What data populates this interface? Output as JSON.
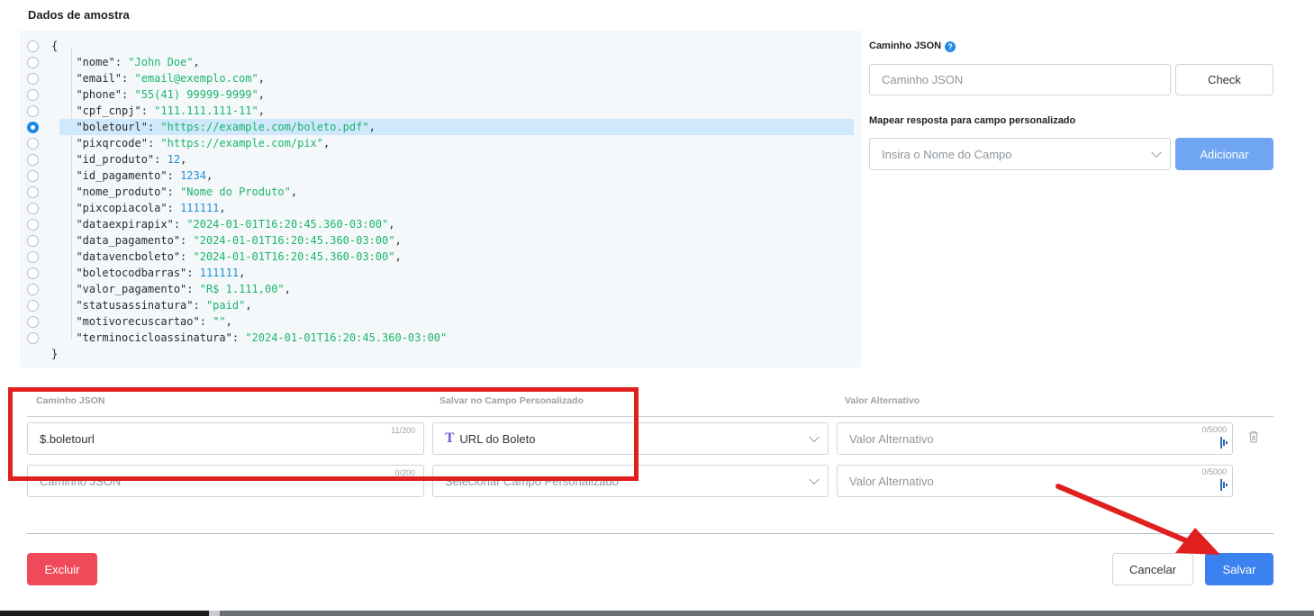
{
  "section_title": "Dados de amostra",
  "json_sample": {
    "open_brace": "{",
    "close_brace": "}",
    "selected_index": 4,
    "lines": [
      {
        "key": "\"nome\"",
        "value": "\"John Doe\"",
        "type": "string",
        "comma": ","
      },
      {
        "key": "\"email\"",
        "value": "\"email@exemplo.com\"",
        "type": "string",
        "comma": ","
      },
      {
        "key": "\"phone\"",
        "value": "\"55(41) 99999-9999\"",
        "type": "string",
        "comma": ","
      },
      {
        "key": "\"cpf_cnpj\"",
        "value": "\"111.111.111-11\"",
        "type": "string",
        "comma": ","
      },
      {
        "key": "\"boletourl\"",
        "value": "\"https://example.com/boleto.pdf\"",
        "type": "string",
        "comma": ","
      },
      {
        "key": "\"pixqrcode\"",
        "value": "\"https://example.com/pix\"",
        "type": "string",
        "comma": ","
      },
      {
        "key": "\"id_produto\"",
        "value": "12",
        "type": "number",
        "comma": ","
      },
      {
        "key": "\"id_pagamento\"",
        "value": "1234",
        "type": "number",
        "comma": ","
      },
      {
        "key": "\"nome_produto\"",
        "value": "\"Nome do Produto\"",
        "type": "string",
        "comma": ","
      },
      {
        "key": "\"pixcopiacola\"",
        "value": "111111",
        "type": "number",
        "comma": ","
      },
      {
        "key": "\"dataexpirapix\"",
        "value": "\"2024-01-01T16:20:45.360-03:00\"",
        "type": "string",
        "comma": ","
      },
      {
        "key": "\"data_pagamento\"",
        "value": "\"2024-01-01T16:20:45.360-03:00\"",
        "type": "string",
        "comma": ","
      },
      {
        "key": "\"datavencboleto\"",
        "value": "\"2024-01-01T16:20:45.360-03:00\"",
        "type": "string",
        "comma": ","
      },
      {
        "key": "\"boletocodbarras\"",
        "value": "111111",
        "type": "number",
        "comma": ","
      },
      {
        "key": "\"valor_pagamento\"",
        "value": "\"R$ 1.111,00\"",
        "type": "string",
        "comma": ","
      },
      {
        "key": "\"statusassinatura\"",
        "value": "\"paid\"",
        "type": "string",
        "comma": ","
      },
      {
        "key": "\"motivorecuscartao\"",
        "value": "\"\"",
        "type": "string",
        "comma": ","
      },
      {
        "key": "\"terminocicloassinatura\"",
        "value": "\"2024-01-01T16:20:45.360-03:00\"",
        "type": "string",
        "comma": ""
      }
    ]
  },
  "right_panel": {
    "json_path_label": "Caminho JSON",
    "help_icon_glyph": "?",
    "json_path_placeholder": "Caminho JSON",
    "check_label": "Check",
    "map_label": "Mapear resposta para campo personalizado",
    "field_name_placeholder": "Insira o Nome do Campo",
    "add_label": "Adicionar"
  },
  "mapping_table": {
    "headers": [
      "Caminho JSON",
      "Salvar no Campo Personalizado",
      "Valor Alternativo"
    ],
    "rows": [
      {
        "path_value": "$.boletourl",
        "path_placeholder": "",
        "path_counter": "11/200",
        "field_value": "URL do Boleto",
        "field_placeholder": "",
        "field_icon": "text-type-icon",
        "alt_placeholder": "Valor Alternativo",
        "alt_counter": "0/5000"
      },
      {
        "path_value": "",
        "path_placeholder": "Caminho JSON",
        "path_counter": "0/200",
        "field_value": "",
        "field_placeholder": "Selecionar Campo Personalizado",
        "field_icon": "",
        "alt_placeholder": "Valor Alternativo",
        "alt_counter": "0/5000"
      }
    ]
  },
  "footer": {
    "delete_label": "Excluir",
    "cancel_label": "Cancelar",
    "save_label": "Salvar"
  },
  "colors": {
    "primary": "#3b82f0",
    "danger": "#f04a5a",
    "json_string": "#1bb56a",
    "json_number": "#1f8fd6",
    "annotation_red": "#e01f1f"
  }
}
